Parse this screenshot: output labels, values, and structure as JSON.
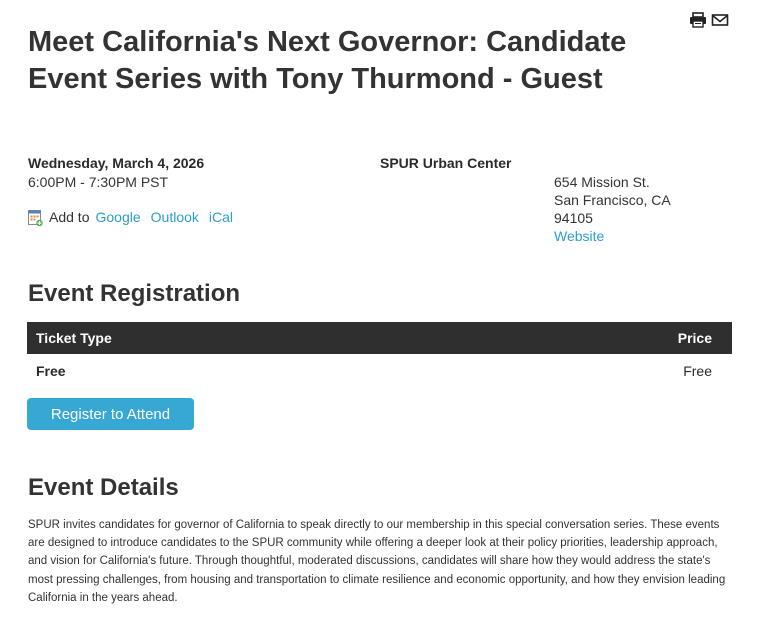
{
  "page": {
    "title": "Meet California's Next Governor: Candidate Event Series with Tony Thurmond - Guest"
  },
  "toolbar": {
    "print_icon": "printer-icon",
    "email_icon": "envelope-icon"
  },
  "event": {
    "date": "Wednesday, March 4, 2026",
    "time": "6:00PM - 7:30PM PST",
    "add_to_label": "Add to",
    "calendar_links": [
      "Google",
      "Outlook",
      "iCal"
    ]
  },
  "location": {
    "venue": "SPUR Urban Center",
    "street": "654 Mission St.",
    "city_state": "San Francisco, CA",
    "zip": "94105",
    "website_label": "Website"
  },
  "registration": {
    "heading": "Event Registration",
    "columns": [
      "Ticket Type",
      "Price"
    ],
    "rows": [
      {
        "type": "Free",
        "price": "Free"
      }
    ],
    "button_label": "Register to Attend"
  },
  "details": {
    "heading": "Event Details",
    "body": "SPUR invites candidates for governor of California to speak directly to our membership in this special conversation series. These events are designed to introduce candidates to the SPUR community while offering a deeper look at their policy priorities, leadership approach, and vision for California's future. Through thoughtful, moderated discussions, candidates will share how they would address the state's most pressing challenges, from housing and transportation to climate resilience and economic opportunity, and how they envision leading California in the years ahead."
  },
  "colors": {
    "link": "#2a9fc9",
    "button": "#37a7d4",
    "table_header": "#2f2f2f"
  }
}
